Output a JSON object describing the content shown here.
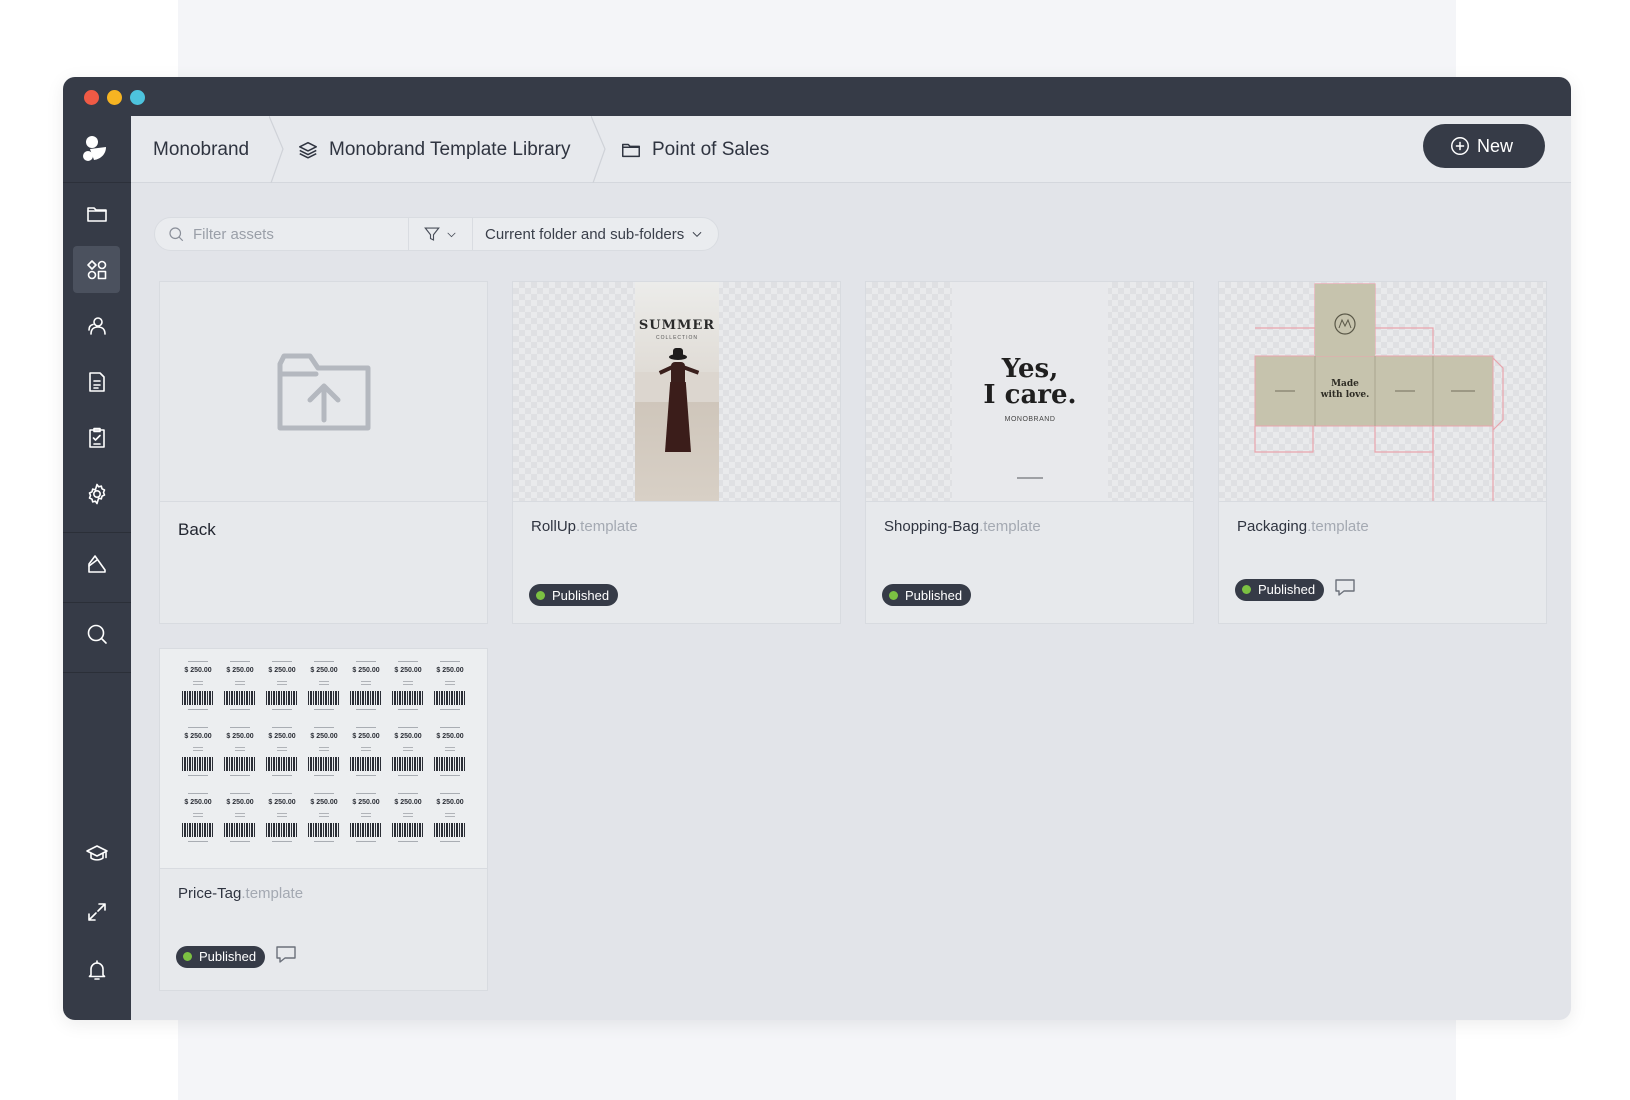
{
  "breadcrumb": {
    "items": [
      {
        "label": "Monobrand",
        "icon": "none"
      },
      {
        "label": "Monobrand Template Library",
        "icon": "layers-icon"
      },
      {
        "label": "Point of Sales",
        "icon": "folder-icon"
      }
    ]
  },
  "header": {
    "new_label": "New"
  },
  "filter": {
    "placeholder": "Filter assets",
    "scope_label": "Current folder and sub-folders"
  },
  "sidebar": {
    "items": [
      "folder-icon",
      "templates-icon",
      "users-icon",
      "document-icon",
      "checklist-icon",
      "gear-icon",
      "chart-icon",
      "search-icon",
      "academy-icon",
      "expand-icon",
      "bell-icon"
    ],
    "active": "templates-icon"
  },
  "cards": [
    {
      "name": "Back"
    },
    {
      "name": "RollUp",
      "ext": ".template",
      "status": "Published",
      "comments": false,
      "preview": {
        "headline": "SUMMER",
        "sub": "COLLECTION"
      }
    },
    {
      "name": "Shopping-Bag",
      "ext": ".template",
      "status": "Published",
      "comments": false,
      "preview": {
        "line1": "Yes,",
        "line2": "I care.",
        "brand": "MONOBRAND"
      }
    },
    {
      "name": "Packaging",
      "ext": ".template",
      "status": "Published",
      "comments": true,
      "preview": {
        "text1": "Made",
        "text2": "with love."
      }
    },
    {
      "name": "Price-Tag",
      "ext": ".template",
      "status": "Published",
      "comments": true,
      "preview": {
        "price": "$ 250.00"
      }
    }
  ],
  "colors": {
    "sidebar_bg": "#363b47",
    "published_dot": "#7cc142",
    "content_bg": "#e2e4e9"
  }
}
